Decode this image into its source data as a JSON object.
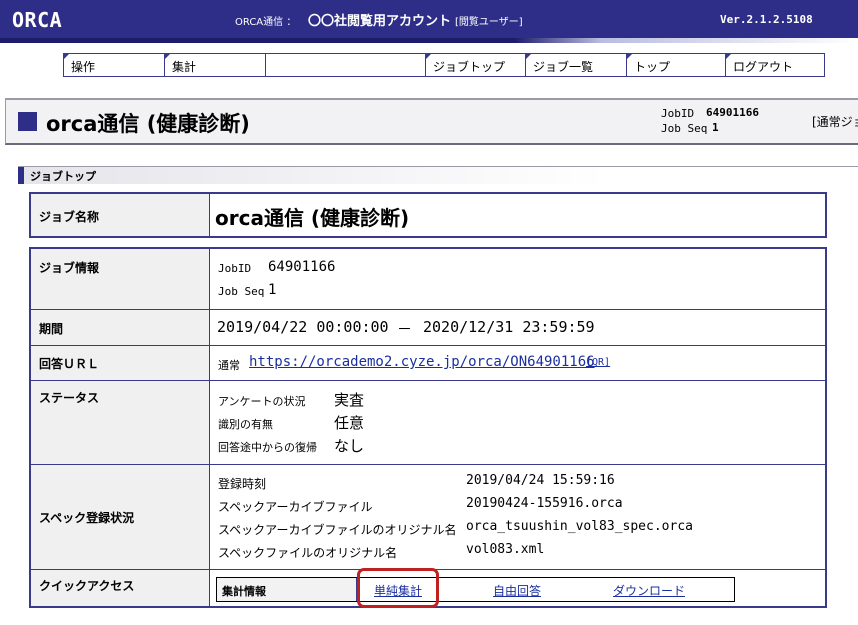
{
  "header": {
    "logo": "ORCA",
    "service_label": "ORCA通信 ：",
    "account_name": "〇〇社閲覧用アカウント",
    "account_role": "[閲覧ユーザー]",
    "version": "Ver.2.1.2.5108"
  },
  "nav": {
    "items": [
      {
        "label": "操作"
      },
      {
        "label": "集計"
      },
      {
        "label": ""
      },
      {
        "label": "ジョブトップ"
      },
      {
        "label": "ジョブ一覧"
      },
      {
        "label": "トップ"
      },
      {
        "label": "ログアウト"
      }
    ]
  },
  "title_band": {
    "title": "orca通信 (健康診断)",
    "job_id_label": "JobID",
    "job_id": "64901166",
    "job_seq_label": "Job Seq",
    "job_seq": "1",
    "type_tag": "[通常ジョ"
  },
  "section": {
    "title": "ジョブトップ"
  },
  "job_name": {
    "label": "ジョブ名称",
    "value": "orca通信 (健康診断)"
  },
  "job_info": {
    "label": "ジョブ情報",
    "job_id_label": "JobID",
    "job_id": "64901166",
    "job_seq_label": "Job Seq",
    "job_seq": "1"
  },
  "period": {
    "label": "期間",
    "start": "2019/04/22 00:00:00",
    "separator": "－",
    "end": "2020/12/31 23:59:59"
  },
  "answer_url": {
    "label": "回答ＵＲＬ",
    "type": "通常",
    "url": "https://orcademo2.cyze.jp/orca/ON64901166",
    "qr": "[QR]"
  },
  "status": {
    "label": "ステータス",
    "items": [
      {
        "name": "アンケートの状況",
        "value": "実査"
      },
      {
        "name": "識別の有無",
        "value": "任意"
      },
      {
        "name": "回答途中からの復帰",
        "value": "なし"
      }
    ]
  },
  "spec": {
    "label": "スペック登録状況",
    "items": [
      {
        "name": "登録時刻",
        "value": "2019/04/24 15:59:16"
      },
      {
        "name": "スペックアーカイブファイル",
        "value": "20190424-155916.orca"
      },
      {
        "name": "スペックアーカイブファイルのオリジナル名",
        "value": "orca_tsuushin_vol83_spec.orca"
      },
      {
        "name": "スペックファイルのオリジナル名",
        "value": "vol083.xml"
      }
    ]
  },
  "quick_access": {
    "label": "クイックアクセス",
    "box_label": "集計情報",
    "links": [
      {
        "label": "単純集計"
      },
      {
        "label": "自由回答"
      },
      {
        "label": "ダウンロード"
      }
    ]
  },
  "colors": {
    "header_bg": "#2e2e88",
    "border": "#3a3a8c",
    "link": "#1a2fa0",
    "highlight": "#c02020"
  }
}
